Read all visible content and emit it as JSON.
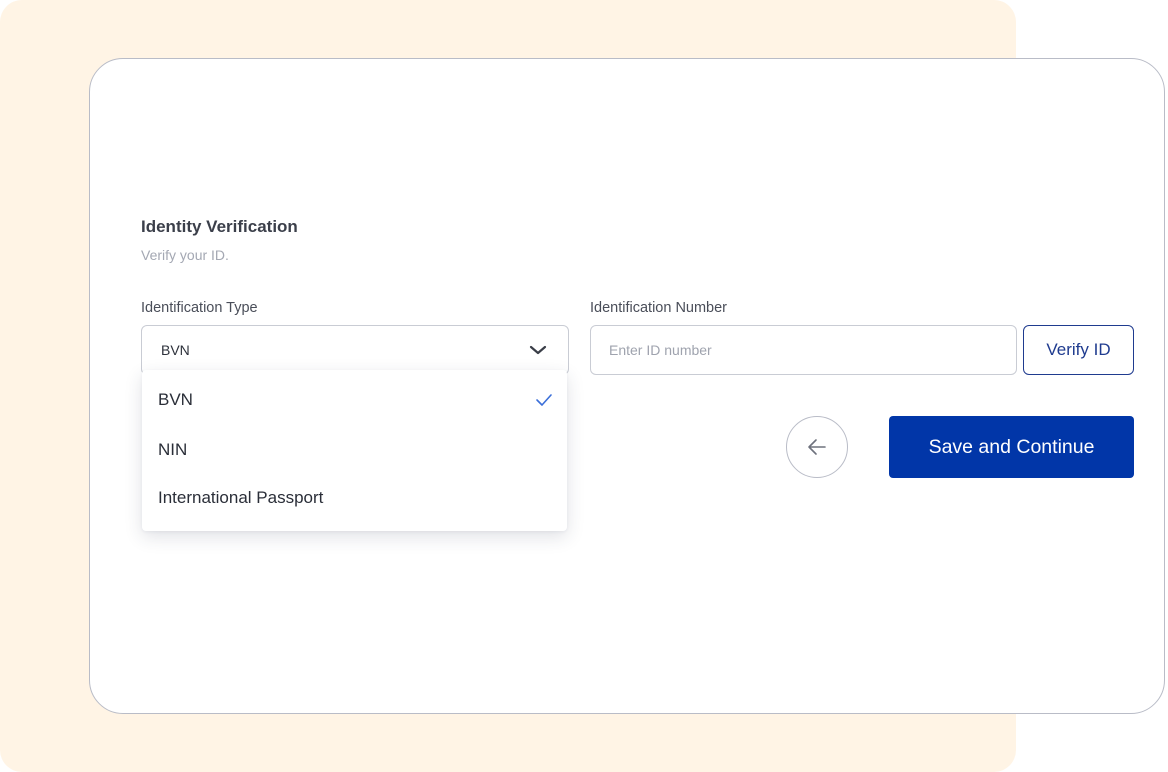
{
  "section": {
    "title": "Identity Verification",
    "subtitle": "Verify your ID."
  },
  "id_type": {
    "label": "Identification Type",
    "selected": "BVN",
    "options": [
      {
        "label": "BVN",
        "selected": true
      },
      {
        "label": "NIN",
        "selected": false
      },
      {
        "label": "International Passport",
        "selected": false
      }
    ]
  },
  "id_number": {
    "label": "Identification Number",
    "value": "",
    "placeholder": "Enter ID number"
  },
  "buttons": {
    "verify_label": "Verify ID",
    "back_icon": "arrow-left-icon",
    "save_label": "Save and Continue"
  },
  "colors": {
    "background_accent": "#fff4e5",
    "primary": "#0136a8",
    "outline_button": "#1f3b8f",
    "check": "#3b6fd9"
  }
}
